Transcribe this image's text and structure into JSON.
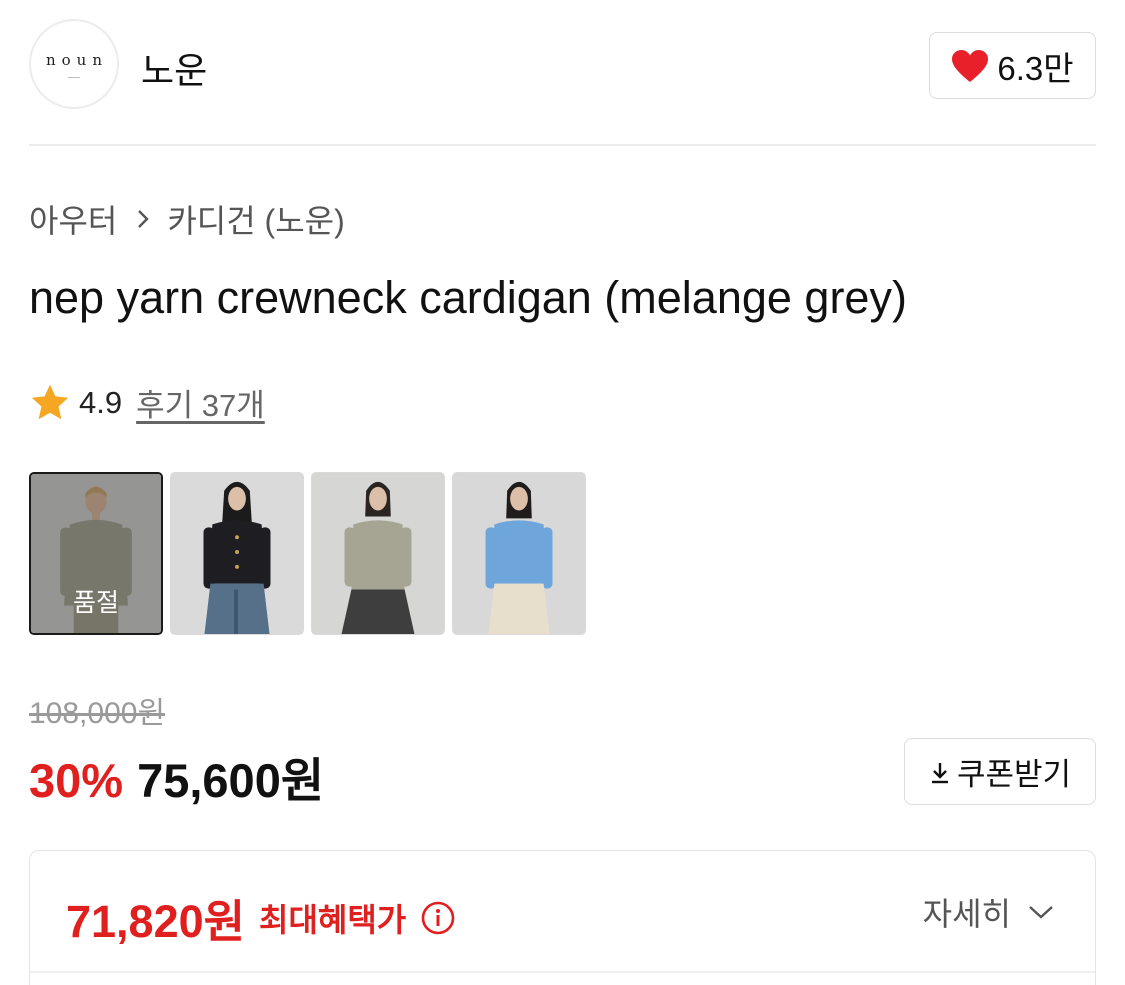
{
  "brand": {
    "logo_text": "noun",
    "name": "노운"
  },
  "like": {
    "count": "6.3만",
    "icon": "heart-icon",
    "color": "#e8202a"
  },
  "breadcrumb": [
    {
      "label": "아우터"
    },
    {
      "label": "카디건 (노운)"
    }
  ],
  "product": {
    "title": "nep yarn crewneck cardigan (melange grey)",
    "rating": "4.9",
    "review_link": "후기 37개"
  },
  "thumbnails": [
    {
      "name": "melange-grey",
      "sold_out_label": "품절",
      "selected": true
    },
    {
      "name": "black"
    },
    {
      "name": "beige"
    },
    {
      "name": "blue"
    }
  ],
  "pricing": {
    "original": "108,000원",
    "discount": "30%",
    "sale": "75,600원",
    "coupon_label": "쿠폰받기",
    "accent": "#e0201f"
  },
  "benefit": {
    "price": "71,820원",
    "label": "최대혜택가",
    "detail_label": "자세히"
  }
}
